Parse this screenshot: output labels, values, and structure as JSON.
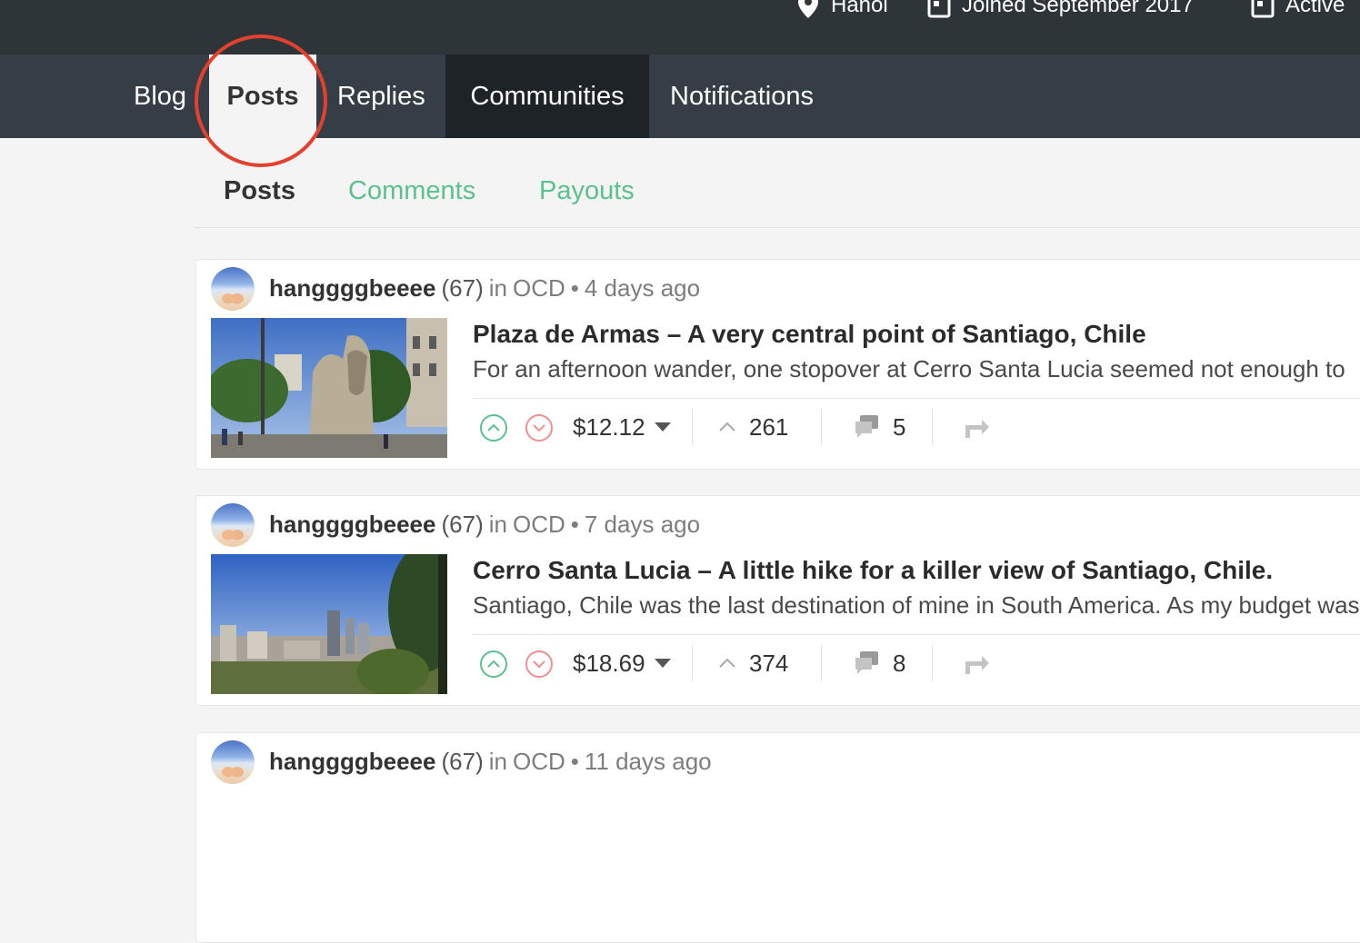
{
  "profile_meta": {
    "location": "Hanoi",
    "joined": "Joined September 2017",
    "active": "Active"
  },
  "nav": {
    "tabs": [
      "Blog",
      "Posts",
      "Replies",
      "Communities",
      "Notifications"
    ],
    "active_tab": "Posts"
  },
  "subtabs": {
    "items": [
      "Posts",
      "Comments",
      "Payouts"
    ],
    "active": "Posts"
  },
  "posts": [
    {
      "author": "hanggggbeeee",
      "reputation": "(67)",
      "in_label": "in",
      "community": "OCD",
      "separator": "•",
      "time": "4 days ago",
      "title": "Plaza de Armas – A very central point of Santiago, Chile",
      "excerpt": "For an afternoon wander, one stopover at Cerro Santa Lucia seemed not enough to",
      "payout": "$12.12",
      "votes": "261",
      "comments": "5"
    },
    {
      "author": "hanggggbeeee",
      "reputation": "(67)",
      "in_label": "in",
      "community": "OCD",
      "separator": "•",
      "time": "7 days ago",
      "title": "Cerro Santa Lucia – A little hike for a killer view of Santiago, Chile.",
      "excerpt": "Santiago, Chile was the last destination of mine in South America. As my budget was",
      "payout": "$18.69",
      "votes": "374",
      "comments": "8"
    },
    {
      "author": "hanggggbeeee",
      "reputation": "(67)",
      "in_label": "in",
      "community": "OCD",
      "separator": "•",
      "time": "11 days ago"
    }
  ],
  "colors": {
    "accent_green": "#5cc08f",
    "downvote_red": "#f08f8f",
    "annotation_red": "#e3402e",
    "nav_bg": "#353d46",
    "topbar_bg": "#2e3539"
  },
  "icons": [
    "location-pin-icon",
    "calendar-icon",
    "upvote-icon",
    "downvote-icon",
    "caret-down-icon",
    "votes-chevron-icon",
    "comments-icon",
    "share-icon"
  ]
}
